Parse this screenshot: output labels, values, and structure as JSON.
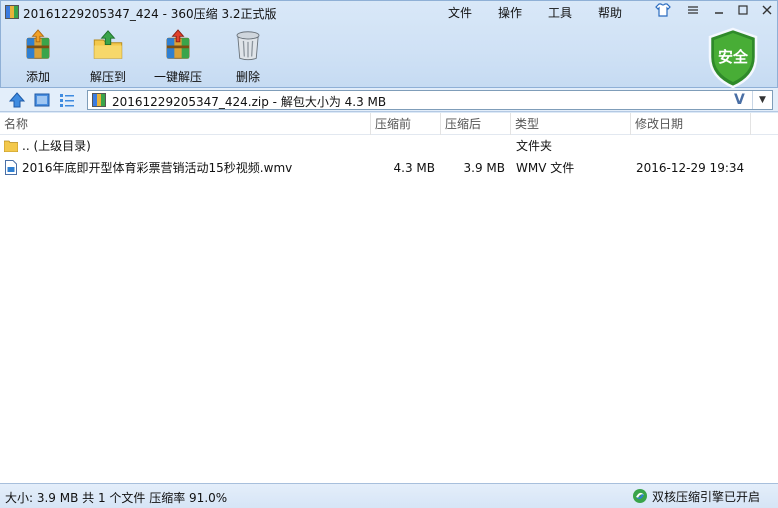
{
  "window": {
    "title": "20161229205347_424 - 360压缩 3.2正式版",
    "menus": [
      "文件",
      "操作",
      "工具",
      "帮助"
    ],
    "security_badge": "安全"
  },
  "toolbar": {
    "add": "添加",
    "extract_to": "解压到",
    "one_click_extract": "一键解压",
    "delete": "删除"
  },
  "address": {
    "path": "20161229205347_424.zip - 解包大小为 4.3 MB",
    "v_button": "V"
  },
  "list": {
    "columns": [
      "名称",
      "压缩前",
      "压缩后",
      "类型",
      "修改日期"
    ],
    "rows": [
      {
        "name": ".. (上级目录)",
        "before": "",
        "after": "",
        "type": "文件夹",
        "date": ""
      },
      {
        "name": "2016年底即开型体育彩票营销活动15秒视频.wmv",
        "before": "4.3 MB",
        "after": "3.9 MB",
        "type": "WMV 文件",
        "date": "2016-12-29 19:34"
      }
    ]
  },
  "status": {
    "summary": "大小: 3.9 MB 共 1 个文件 压缩率 91.0%",
    "engine": "双核压缩引擎已开启"
  },
  "colors": {
    "accent": "#2f7fd1",
    "shield_green": "#3a9a2e",
    "folder_yellow": "#f3c84b"
  }
}
